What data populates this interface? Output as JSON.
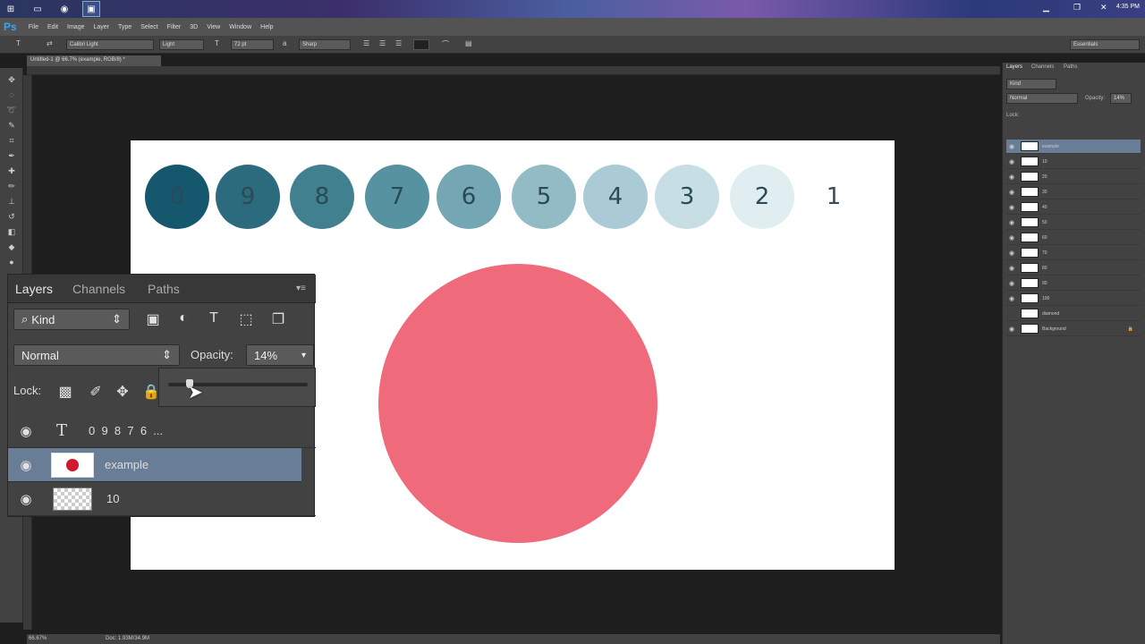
{
  "taskbar": {
    "clock": "4:35 PM"
  },
  "app": {
    "logo": "Ps"
  },
  "menu": [
    "File",
    "Edit",
    "Image",
    "Layer",
    "Type",
    "Select",
    "Filter",
    "3D",
    "View",
    "Window",
    "Help"
  ],
  "options": {
    "font_family": "Calibri Light",
    "font_style": "Light",
    "font_size": "72 pt",
    "antialias": "Sharp",
    "workspace": "Essentials"
  },
  "document": {
    "tab_title": "Untitled-1 @ 66.7% (example, RGB/8) *",
    "zoom": "66.67%",
    "doc_size": "Doc: 1.93M/34.9M"
  },
  "swatches": [
    {
      "label": "0",
      "color": "#15576c"
    },
    {
      "label": "9",
      "color": "#2c6b7d"
    },
    {
      "label": "8",
      "color": "#40808f"
    },
    {
      "label": "7",
      "color": "#5792a0"
    },
    {
      "label": "6",
      "color": "#74a7b3"
    },
    {
      "label": "5",
      "color": "#93bbc6"
    },
    {
      "label": "4",
      "color": "#aacbd5"
    },
    {
      "label": "3",
      "color": "#c7dee4"
    },
    {
      "label": "2",
      "color": "#e1eef1"
    },
    {
      "label": "1",
      "color": "#ffffff"
    }
  ],
  "big_circle_color": "#ef6a7a",
  "right_panel": {
    "tabs": [
      "Layers",
      "Channels",
      "Paths"
    ],
    "kind": "Kind",
    "blend": "Normal",
    "opacity_label": "Opacity:",
    "opacity": "14%",
    "lock_label": "Lock:",
    "layers": [
      "example",
      "10",
      "20",
      "30",
      "40",
      "50",
      "60",
      "70",
      "80",
      "90",
      "100",
      "diamond",
      "Background"
    ]
  },
  "zoom_panel": {
    "tabs": [
      "Layers",
      "Channels",
      "Paths"
    ],
    "kind": "Kind",
    "blend": "Normal",
    "opacity_label": "Opacity:",
    "opacity": "14%",
    "lock_label": "Lock:",
    "text_layer_digits": "0  9  8  7  6  ...",
    "layer_selected": "example",
    "layer_below": "10"
  }
}
